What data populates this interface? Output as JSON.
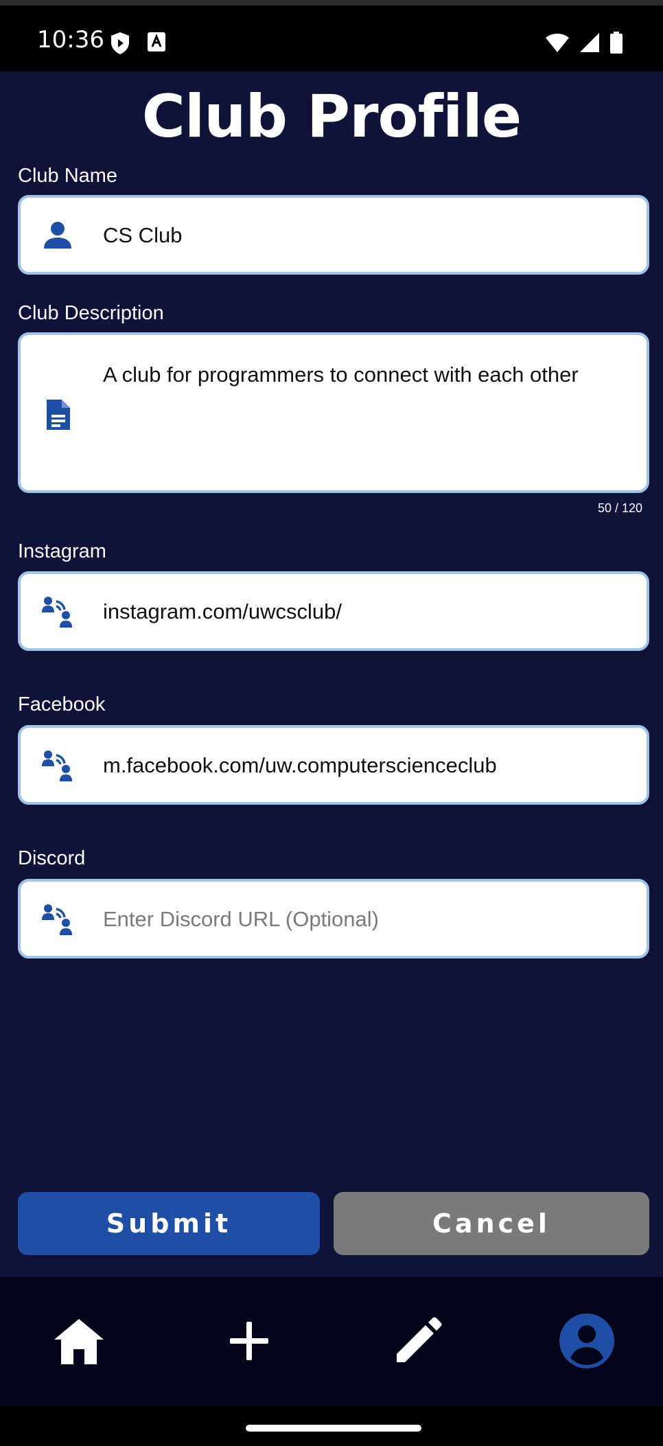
{
  "status_bar": {
    "time": "10:36"
  },
  "page": {
    "title": "Club Profile"
  },
  "fields": {
    "club_name": {
      "label": "Club Name",
      "value": "CS Club",
      "icon": "person-icon"
    },
    "club_description": {
      "label": "Club Description",
      "value": "A club for programmers to connect with each other",
      "counter": "50 / 120",
      "icon": "document-icon"
    },
    "instagram": {
      "label": "Instagram",
      "value": "instagram.com/uwcsclub/",
      "icon": "connect-people-icon"
    },
    "facebook": {
      "label": "Facebook",
      "value": "m.facebook.com/uw.computerscienceclub",
      "icon": "connect-people-icon"
    },
    "discord": {
      "label": "Discord",
      "value": "",
      "placeholder": "Enter Discord URL (Optional)",
      "icon": "connect-people-icon"
    }
  },
  "actions": {
    "submit_label": "Submit",
    "cancel_label": "Cancel"
  },
  "nav": {
    "items": [
      {
        "icon": "home-icon"
      },
      {
        "icon": "plus-icon"
      },
      {
        "icon": "edit-icon"
      },
      {
        "icon": "profile-icon",
        "active": true
      }
    ]
  },
  "colors": {
    "background": "#10123a",
    "accent": "#1f4ea6",
    "icon_blue": "#1f4ea6",
    "field_border": "#9fc4e6",
    "cancel_gray": "#7a7a7a",
    "nav_background": "#04051a"
  }
}
